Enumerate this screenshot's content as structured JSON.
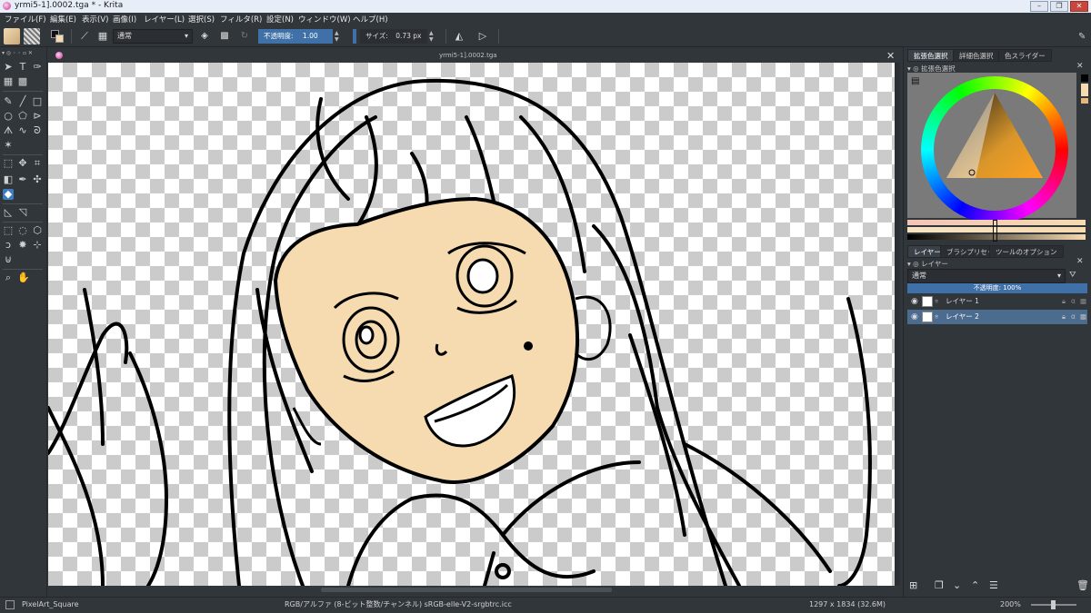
{
  "window": {
    "title": "yrmi5-1].0002.tga * - Krita"
  },
  "menu": [
    "ファイル(F)",
    "編集(E)",
    "表示(V)",
    "画像(I)",
    "レイヤー(L)",
    "選択(S)",
    "フィルタ(R)",
    "設定(N)",
    "ウィンドウ(W)",
    "ヘルプ(H)"
  ],
  "toolbar": {
    "blend_mode": "通常",
    "opacity_label": "不透明度:",
    "opacity_value": "1.00",
    "size_label": "サイズ:",
    "size_value": "0.73 px"
  },
  "document": {
    "tab_title": "yrmi5-1].0002.tga"
  },
  "dock": {
    "color_tabs": [
      "拡張色選択",
      "詳細色選択",
      "色スライダー"
    ],
    "color_panel_title": "拡張色選択",
    "bottom_tabs": [
      "レイヤー",
      "ブラシプリセット",
      "ツールのオプション"
    ],
    "layers_title": "レイヤー",
    "layer_blend_mode": "通常",
    "layer_opacity": "不透明度: 100%",
    "layers": [
      {
        "name": "レイヤー 1",
        "selected": false
      },
      {
        "name": "レイヤー 2",
        "selected": true
      }
    ]
  },
  "status": {
    "brush": "PixelArt_Square",
    "color_profile": "RGB/アルファ (8-ビット整数/チャンネル)  sRGB-elle-V2-srgbtrc.icc",
    "image_size": "1297 x 1834 (32.6M)",
    "zoom": "200%"
  },
  "colors": {
    "accent": "#3d7dbf",
    "skin": "#f6dab0",
    "background": "#31363b"
  }
}
